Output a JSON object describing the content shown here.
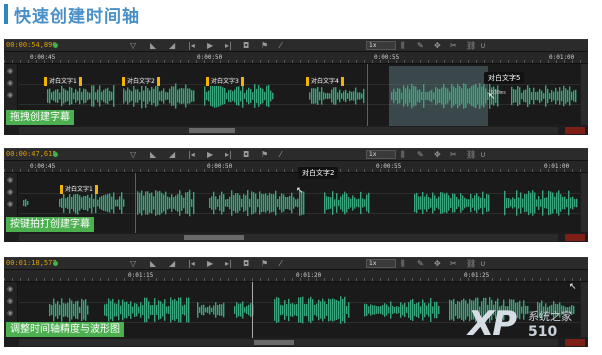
{
  "title": "快速创建时间轴",
  "panels": [
    {
      "timecode": "00:00:54,890",
      "speed": "1x",
      "ticks": [
        "0:00:45",
        "0:00:50",
        "0:00:55",
        "0:01:00"
      ],
      "subtitles": [
        "对白文字1",
        "对白文字2",
        "对白文字3",
        "对白文字4"
      ],
      "tooltip": "对白文字5",
      "note": "2930ms",
      "caption": "拖拽创建字幕"
    },
    {
      "timecode": "00:00:47,615",
      "speed": "1x",
      "ticks": [
        "0:00:45",
        "0:00:50",
        "0:00:55",
        "0:01:00"
      ],
      "subtitles": [
        "对白文字1"
      ],
      "tooltip": "对白文字2",
      "caption": "按键拍打创建字幕"
    },
    {
      "timecode": "00:01:18,577",
      "speed": "1x",
      "ticks": [
        "0:01:15",
        "0:01:20",
        "0:01:25"
      ],
      "caption": "调整时间轴精度与波形图"
    }
  ],
  "watermark": {
    "brand": "XP",
    "site": "系统之家",
    "num": "510"
  },
  "icons": [
    "eye-icon",
    "filter-icon",
    "skip-back-icon",
    "play-icon",
    "camera-icon",
    "flag-icon",
    "scissors-icon",
    "edit-icon",
    "magnet-icon"
  ],
  "colors": {
    "accent": "#4caf50",
    "wave": "#3aa57d",
    "label_border": "#f2b400",
    "playhead": "#c0392b"
  }
}
